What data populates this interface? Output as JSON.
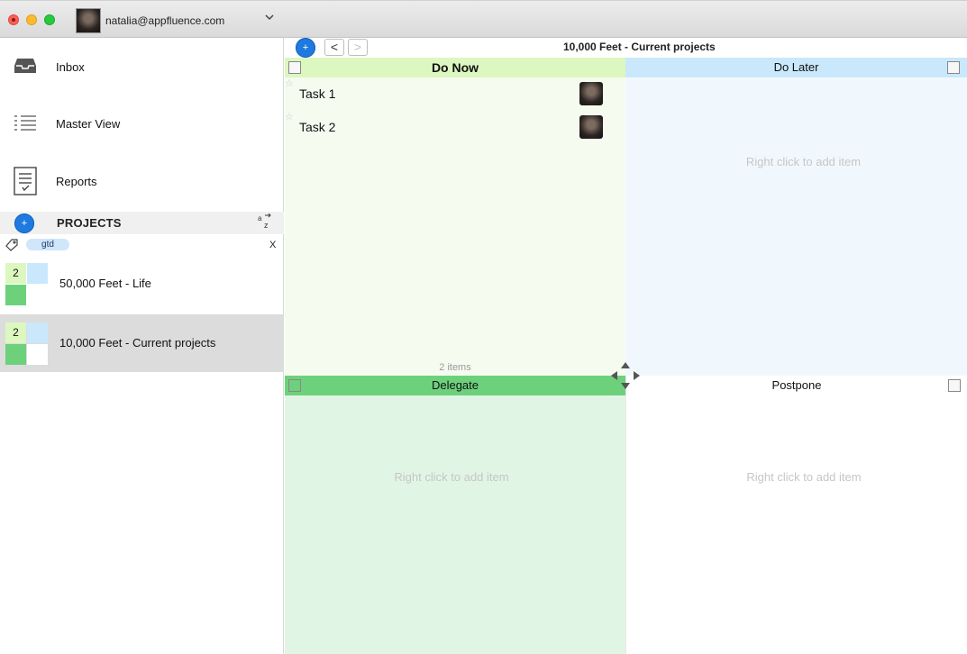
{
  "window": {
    "account_email": "natalia@appfluence.com"
  },
  "sidebar": {
    "nav": [
      {
        "label": "Inbox",
        "icon": "inbox-icon"
      },
      {
        "label": "Master View",
        "icon": "list-icon"
      },
      {
        "label": "Reports",
        "icon": "report-icon"
      }
    ],
    "projects_header": "PROJECTS",
    "add_icon": "+",
    "sort_icon": "az-sort-icon",
    "tag_filter": {
      "tag": "gtd",
      "clear": "X"
    },
    "projects": [
      {
        "count": "2",
        "name": "50,000 Feet - Life",
        "selected": false
      },
      {
        "count": "2",
        "name": "10,000 Feet - Current projects",
        "selected": true
      }
    ]
  },
  "main": {
    "add_icon": "+",
    "back_icon": "<",
    "forward_icon": ">",
    "title": "10,000 Feet - Current projects",
    "quadrants": {
      "do_now": {
        "title": "Do Now",
        "color": "#dcf7bf",
        "bg": "#f5fcef",
        "tasks": [
          {
            "label": "Task 1"
          },
          {
            "label": "Task 2"
          }
        ],
        "count_label": "2 items"
      },
      "do_later": {
        "title": "Do Later",
        "color": "#c9e8fb",
        "bg": "#f1f8fd",
        "empty_hint": "Right click to add item"
      },
      "delegate": {
        "title": "Delegate",
        "color": "#6dd17c",
        "bg": "#e1f5e4",
        "empty_hint": "Right click to add item"
      },
      "postpone": {
        "title": "Postpone",
        "color": "#ffffff",
        "bg": "#ffffff",
        "empty_hint": "Right click to add item"
      }
    }
  }
}
